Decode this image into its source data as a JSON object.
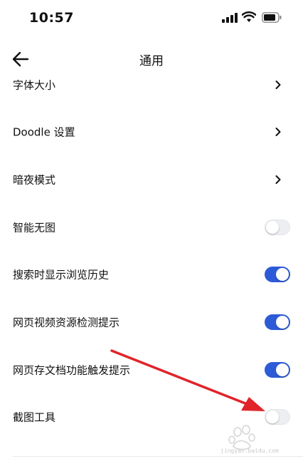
{
  "status_bar": {
    "time": "10:57"
  },
  "header": {
    "title": "通用"
  },
  "settings": {
    "items": [
      {
        "label": "字体大小",
        "control": "chevron"
      },
      {
        "label": "Doodle 设置",
        "control": "chevron"
      },
      {
        "label": "暗夜模式",
        "control": "chevron"
      },
      {
        "label": "智能无图",
        "control": "toggle",
        "enabled": false
      },
      {
        "label": "搜索时显示浏览历史",
        "control": "toggle",
        "enabled": true
      },
      {
        "label": "网页视频资源检测提示",
        "control": "toggle",
        "enabled": true
      },
      {
        "label": "网页存文档功能触发提示",
        "control": "toggle",
        "enabled": true
      },
      {
        "label": "截图工具",
        "control": "toggle",
        "enabled": false
      }
    ]
  },
  "watermark": {
    "text": "jingyan.baidu.com"
  },
  "colors": {
    "accent": "#2d5bd8",
    "annotation_arrow": "#e0242a"
  },
  "icons": [
    "signal-icon",
    "wifi-icon",
    "battery-icon",
    "back-arrow-icon",
    "chevron-right-icon",
    "red-annotation-arrow"
  ]
}
